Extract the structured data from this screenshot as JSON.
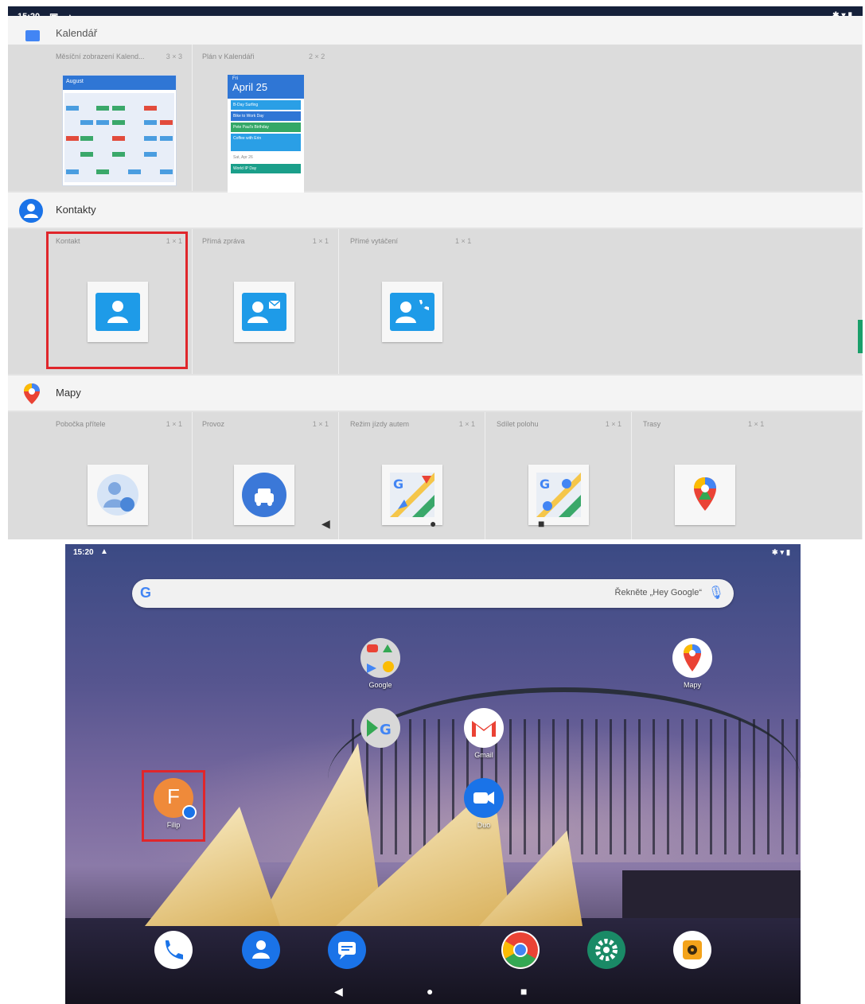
{
  "top_screen": {
    "status": {
      "time": "15:20"
    },
    "calendar_section": {
      "title": "Kalendář",
      "widgets": [
        {
          "name": "Měsíční zobrazení Kalend...",
          "size": "3 × 3"
        },
        {
          "name": "Plán v Kalendáři",
          "size": "2 × 2"
        }
      ],
      "month_header": "August",
      "agenda": {
        "day": "Fri",
        "date": "April 25",
        "events": [
          "B-Day Surfing",
          "Bike to Work Day",
          "Pete Paul's Birthday",
          "Coffee with Erin",
          "Sat, Apr 26",
          "World IP Day"
        ]
      }
    },
    "contacts_section": {
      "title": "Kontakty",
      "widgets": [
        {
          "name": "Kontakt",
          "size": "1 × 1"
        },
        {
          "name": "Přímá zpráva",
          "size": "1 × 1"
        },
        {
          "name": "Přímé vytáčení",
          "size": "1 × 1"
        }
      ]
    },
    "maps_section": {
      "title": "Mapy",
      "widgets": [
        {
          "name": "Pobočka přítele",
          "size": "1 × 1"
        },
        {
          "name": "Provoz",
          "size": "1 × 1"
        },
        {
          "name": "Režim jízdy autem",
          "size": "1 × 1"
        },
        {
          "name": "Sdílet polohu",
          "size": "1 × 1"
        },
        {
          "name": "Trasy",
          "size": "1 × 1"
        }
      ]
    }
  },
  "home_screen": {
    "status": {
      "time": "15:20"
    },
    "search": {
      "hint": "Řekněte „Hey Google“"
    },
    "apps": {
      "google": "Google",
      "maps": "Mapy",
      "gmail": "Gmail",
      "duo": "Duo",
      "contact_shortcut": {
        "letter": "F",
        "label": "Filip"
      }
    },
    "dock": [
      "phone-icon",
      "contacts-icon",
      "messages-icon",
      "chrome-icon",
      "settings-icon",
      "music-icon"
    ]
  },
  "colors": {
    "accent": "#1a73e8",
    "highlight": "#e0262b",
    "statusbar": "#15203a"
  }
}
